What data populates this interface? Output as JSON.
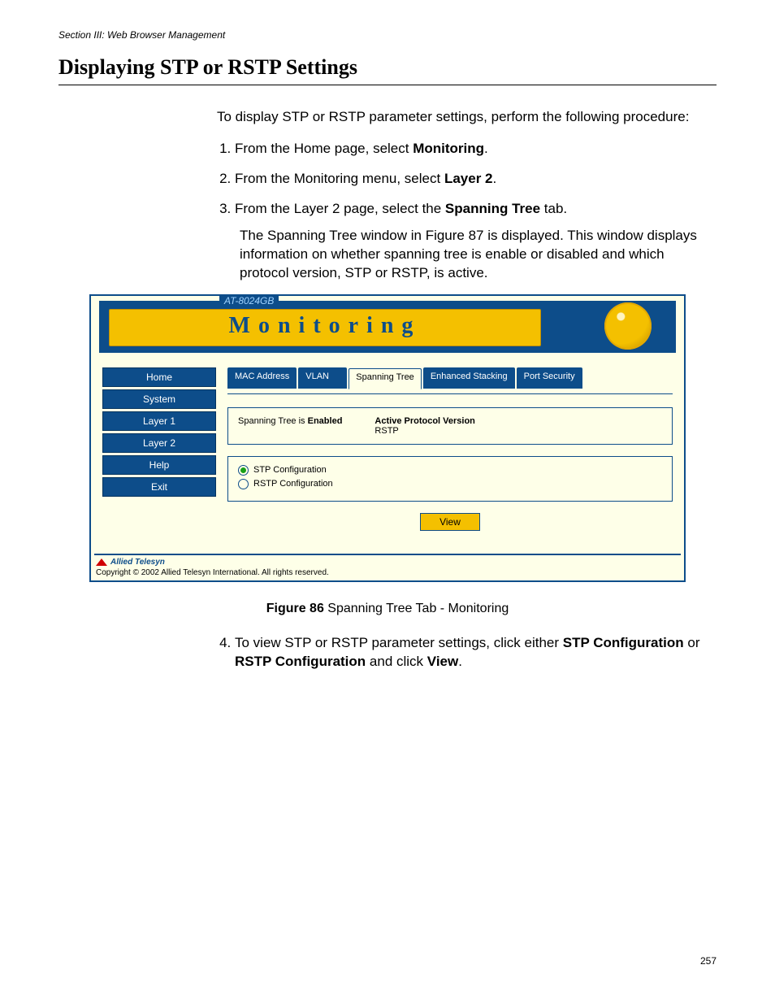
{
  "running_head": "Section III: Web Browser Management",
  "title": "Displaying STP or RSTP Settings",
  "intro": "To display STP or RSTP parameter settings, perform the following procedure:",
  "steps": {
    "s1a": "From the Home page, select ",
    "s1b": "Monitoring",
    "s1c": ".",
    "s2a": "From the Monitoring menu, select ",
    "s2b": "Layer 2",
    "s2c": ".",
    "s3a": "From the Layer 2 page, select the ",
    "s3b": "Spanning Tree",
    "s3c": " tab.",
    "s3_para": "The Spanning Tree window in Figure 87 is displayed. This window displays information on whether spanning tree is enable or disabled and which protocol version, STP or RSTP, is active.",
    "s4a": "To view STP or RSTP parameter settings, click either ",
    "s4b": "STP Configuration",
    "s4c": " or ",
    "s4d": "RSTP Configuration",
    "s4e": " and click ",
    "s4f": "View",
    "s4g": "."
  },
  "figure": {
    "label_b": "Figure 86",
    "label_r": "  Spanning Tree Tab - Monitoring"
  },
  "shot": {
    "model": "AT-8024GB",
    "monitoring_title": "Monitoring",
    "nav": {
      "home": "Home",
      "system": "System",
      "layer1": "Layer 1",
      "layer2": "Layer 2",
      "help": "Help",
      "exit": "Exit"
    },
    "tabs": {
      "mac": "MAC Address",
      "vlan": "VLAN",
      "span": "Spanning Tree",
      "stack": "Enhanced Stacking",
      "sec": "Port Security"
    },
    "status": {
      "st_pre": "Spanning Tree is ",
      "st_b": "Enabled",
      "apv_lbl": "Active Protocol Version",
      "apv_val": "RSTP"
    },
    "radios": {
      "stp": "STP Configuration",
      "rstp": "RSTP Configuration"
    },
    "view_btn": "View",
    "footer_brand": "Allied Telesyn",
    "footer_copy": "Copyright © 2002 Allied Telesyn International. All rights reserved."
  },
  "page_number": "257"
}
